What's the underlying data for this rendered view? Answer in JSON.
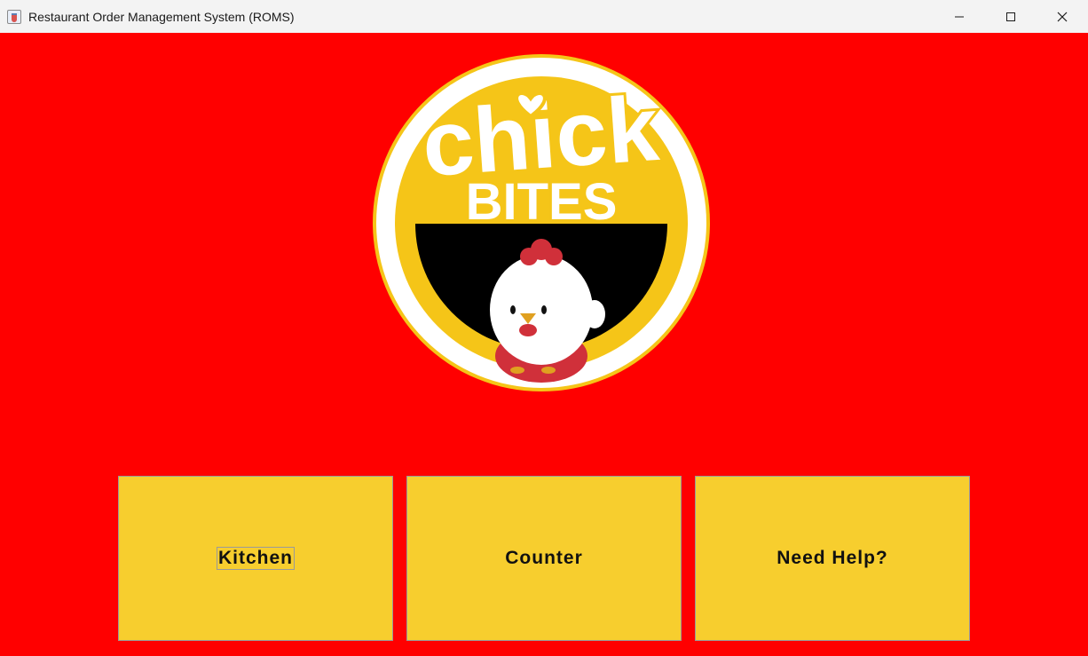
{
  "window": {
    "title": "Restaurant Order Management System (ROMS)",
    "controls": {
      "minimize_icon": "minimize-icon",
      "maximize_icon": "maximize-icon",
      "close_icon": "close-icon"
    }
  },
  "logo": {
    "line1": "chick",
    "line2": "BITES",
    "icon": "chicken-mascot"
  },
  "menu": {
    "kitchen_label": "Kitchen",
    "counter_label": "Counter",
    "help_label": "Need Help?",
    "focused": "Kitchen"
  },
  "colors": {
    "background": "#ff0000",
    "button": "#f7ce2e",
    "logo_yellow": "#f5c518",
    "titlebar": "#f3f3f3"
  }
}
